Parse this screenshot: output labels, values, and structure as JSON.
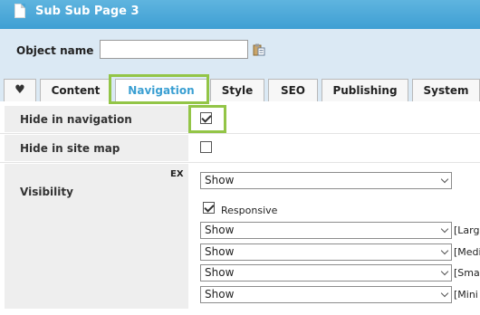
{
  "window": {
    "title": "Sub Sub Page 3"
  },
  "object": {
    "label": "Object name",
    "value": "",
    "placeholder": ""
  },
  "tabs": [
    {
      "label": ""
    },
    {
      "label": "Content"
    },
    {
      "label": "Navigation"
    },
    {
      "label": "Style"
    },
    {
      "label": "SEO"
    },
    {
      "label": "Publishing"
    },
    {
      "label": "System"
    }
  ],
  "active_tab": "Navigation",
  "colors": {
    "accent": "#3a9fd2",
    "highlight": "#93c547",
    "header": "#4aa6d7",
    "panel": "#dbe9f4"
  },
  "fields": {
    "hide_in_navigation": {
      "label": "Hide in navigation",
      "checked": true
    },
    "hide_in_sitemap": {
      "label": "Hide in site map",
      "checked": false
    },
    "visibility": {
      "label": "Visibility",
      "badge": "EX",
      "main": "Show",
      "responsive_label": "Responsive",
      "responsive_checked": true,
      "breakpoints": [
        {
          "value": "Show",
          "tag": "[Larg"
        },
        {
          "value": "Show",
          "tag": "[Medi"
        },
        {
          "value": "Show",
          "tag": "[Sma"
        },
        {
          "value": "Show",
          "tag": "[Mini"
        }
      ]
    }
  }
}
